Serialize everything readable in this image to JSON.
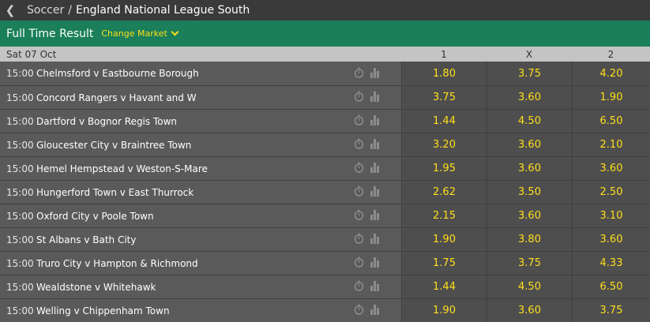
{
  "breadcrumb": {
    "root": "Soccer",
    "separator": "/",
    "current": "England National League South"
  },
  "icons": {
    "back": "chevron-left-icon",
    "stopwatch": "stopwatch-icon",
    "stats": "bar-chart-icon",
    "change": "chevron-down-icon"
  },
  "market": {
    "title": "Full Time Result",
    "change_label": "Change Market"
  },
  "columns": {
    "date": "Sat 07 Oct",
    "home": "1",
    "draw": "X",
    "away": "2"
  },
  "colors": {
    "accent_green": "#1a7f5a",
    "odds_yellow": "#ffdf1b"
  },
  "matches": [
    {
      "time": "15:00",
      "teams": "Chelmsford v Eastbourne Borough",
      "home": "1.80",
      "draw": "3.75",
      "away": "4.20"
    },
    {
      "time": "15:00",
      "teams": "Concord Rangers v Havant and W",
      "home": "3.75",
      "draw": "3.60",
      "away": "1.90"
    },
    {
      "time": "15:00",
      "teams": "Dartford v Bognor Regis Town",
      "home": "1.44",
      "draw": "4.50",
      "away": "6.50"
    },
    {
      "time": "15:00",
      "teams": "Gloucester City v Braintree Town",
      "home": "3.20",
      "draw": "3.60",
      "away": "2.10"
    },
    {
      "time": "15:00",
      "teams": "Hemel Hempstead v Weston-S-Mare",
      "home": "1.95",
      "draw": "3.60",
      "away": "3.60"
    },
    {
      "time": "15:00",
      "teams": "Hungerford Town v East Thurrock",
      "home": "2.62",
      "draw": "3.50",
      "away": "2.50"
    },
    {
      "time": "15:00",
      "teams": "Oxford City v Poole Town",
      "home": "2.15",
      "draw": "3.60",
      "away": "3.10"
    },
    {
      "time": "15:00",
      "teams": "St Albans v Bath City",
      "home": "1.90",
      "draw": "3.80",
      "away": "3.60"
    },
    {
      "time": "15:00",
      "teams": "Truro City v Hampton & Richmond",
      "home": "1.75",
      "draw": "3.75",
      "away": "4.33"
    },
    {
      "time": "15:00",
      "teams": "Wealdstone v Whitehawk",
      "home": "1.44",
      "draw": "4.50",
      "away": "6.50"
    },
    {
      "time": "15:00",
      "teams": "Welling v Chippenham Town",
      "home": "1.90",
      "draw": "3.60",
      "away": "3.75"
    }
  ]
}
